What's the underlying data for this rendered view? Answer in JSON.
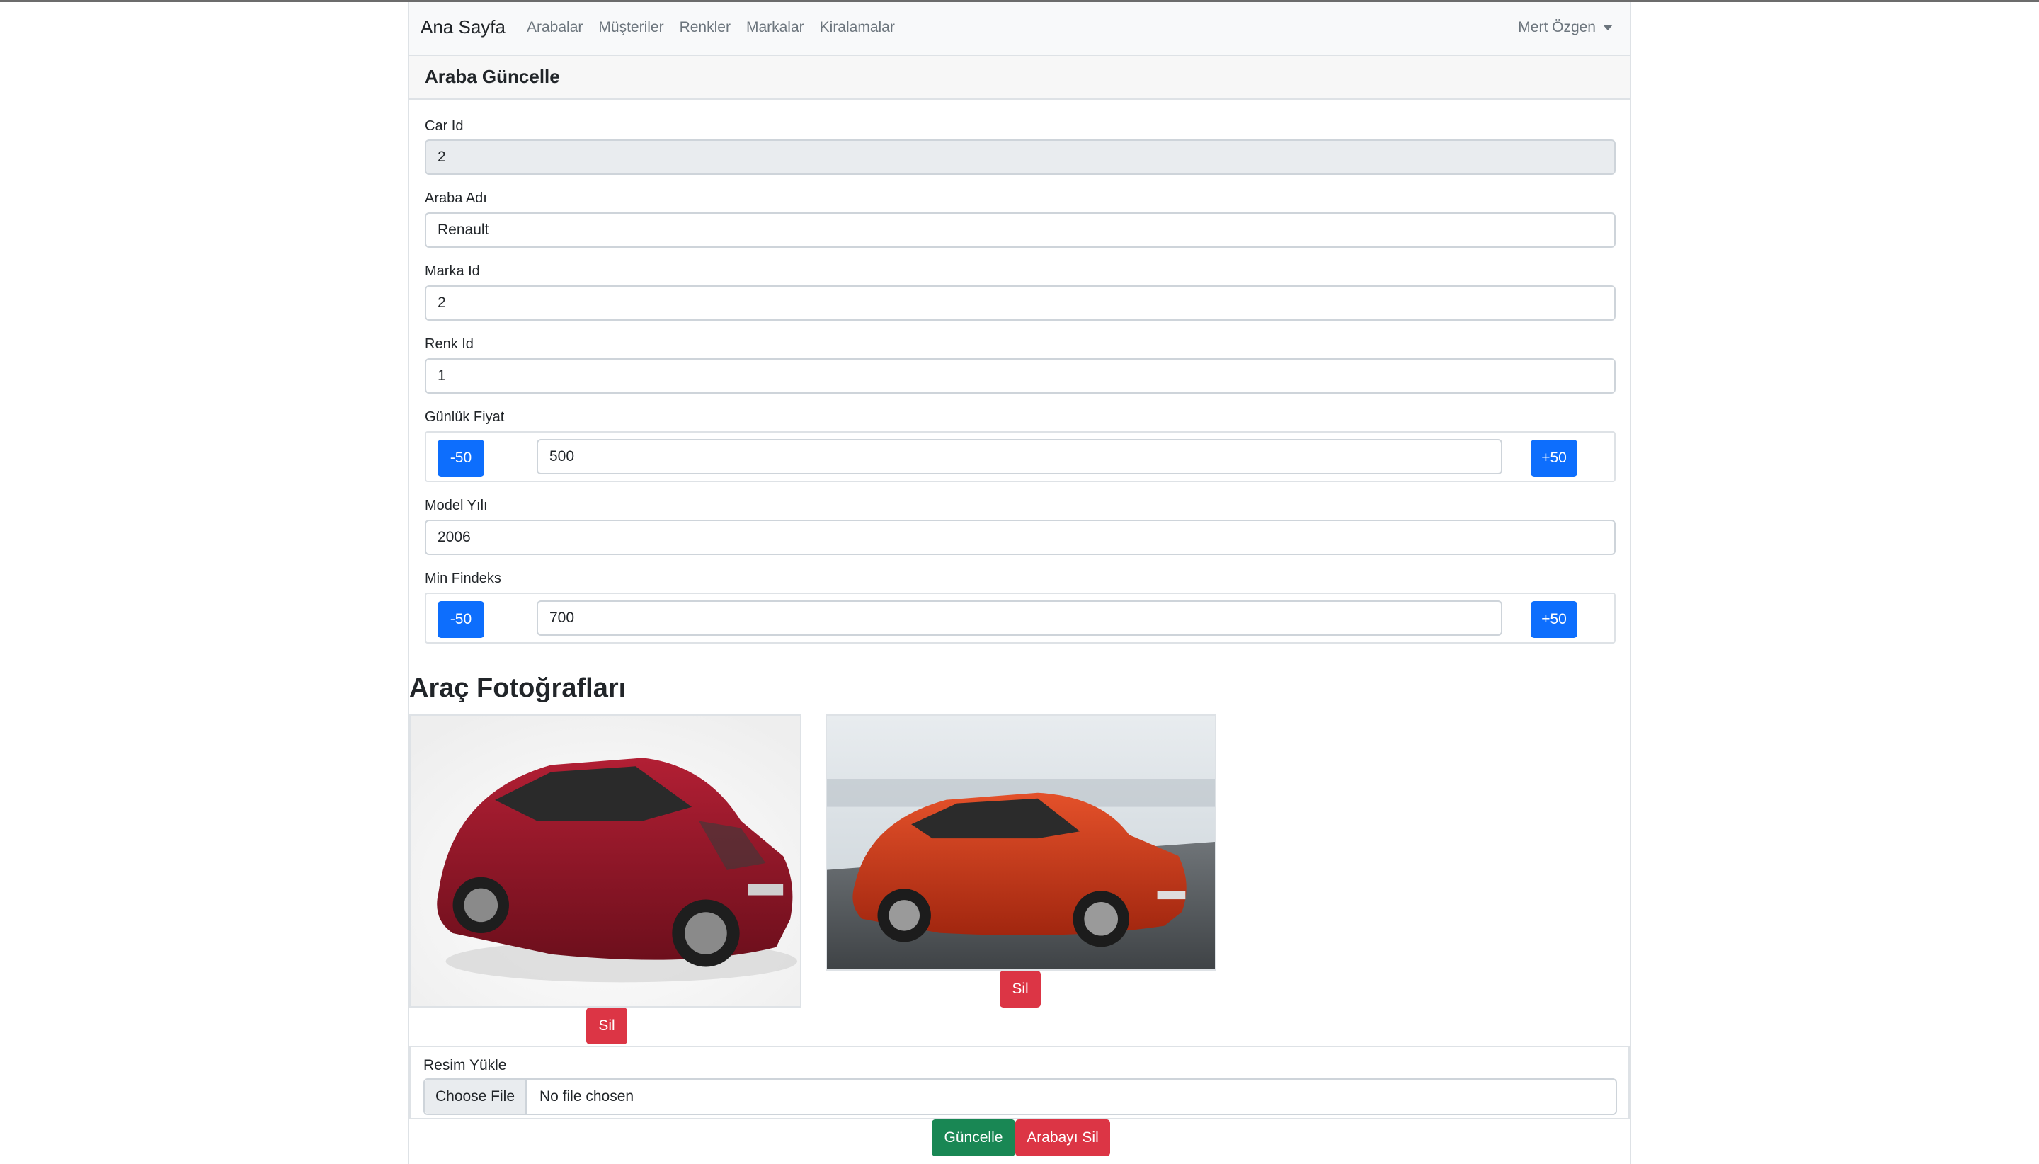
{
  "navbar": {
    "brand": "Ana Sayfa",
    "links": [
      "Arabalar",
      "Müşteriler",
      "Renkler",
      "Markalar",
      "Kiralamalar"
    ],
    "user": "Mert Özgen"
  },
  "card": {
    "title": "Araba Güncelle"
  },
  "form": {
    "car_id": {
      "label": "Car Id",
      "value": "2"
    },
    "car_name": {
      "label": "Araba Adı",
      "value": "Renault"
    },
    "brand_id": {
      "label": "Marka Id",
      "value": "2"
    },
    "color_id": {
      "label": "Renk Id",
      "value": "1"
    },
    "daily_price": {
      "label": "Günlük Fiyat",
      "value": "500",
      "minus_label": "-50",
      "plus_label": "+50"
    },
    "model_year": {
      "label": "Model Yılı",
      "value": "2006"
    },
    "min_findeks": {
      "label": "Min Findeks",
      "value": "700",
      "minus_label": "-50",
      "plus_label": "+50"
    }
  },
  "photos": {
    "title": "Araç Fotoğrafları",
    "items": [
      {
        "alt": "red-renault-clio-white-background",
        "delete_label": "Sil"
      },
      {
        "alt": "orange-renault-clio-road",
        "delete_label": "Sil"
      }
    ]
  },
  "upload": {
    "label": "Resim Yükle",
    "button": "Choose File",
    "status": "No file chosen"
  },
  "actions": {
    "update": "Güncelle",
    "delete_car": "Arabayı Sil"
  },
  "colors": {
    "primary": "#0d6efd",
    "danger": "#dc3545",
    "success": "#198754"
  }
}
